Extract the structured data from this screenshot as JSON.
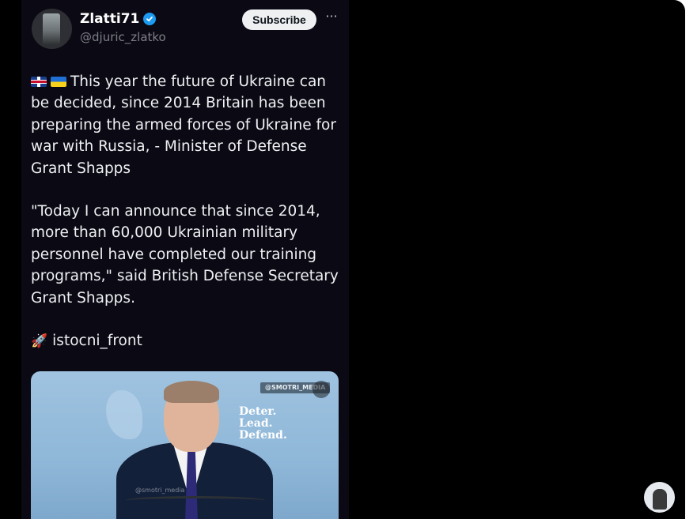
{
  "post": {
    "author_name": "Zlatti71",
    "author_handle": "@djuric_zlatko",
    "subscribe_label": "Subscribe",
    "more_label": "···",
    "paragraph1": "This year the future of Ukraine can be decided, since 2014 Britain has been preparing the armed forces of Ukraine for war with Russia, - Minister of Defense Grant Shapps",
    "paragraph2": "\"Today I can announce that since 2014, more than 60,000 Ukrainian military personnel have completed our training programs,\" said British Defense Secretary Grant Shapps.",
    "source": "istocni_front",
    "icons": [
      "uk-flag-icon",
      "ukraine-flag-icon",
      "rocket-icon",
      "verified-icon"
    ]
  },
  "media": {
    "watermark": "@SMOTRI_MEDIA",
    "slogan_line1": "Deter.",
    "slogan_line2": "Lead.",
    "slogan_line3": "Defend.",
    "overlay_watermark": "@smotri_media"
  },
  "colors": {
    "background": "#000000",
    "post_background": "#0b0a14",
    "verified": "#1d9bf0",
    "text": "#eef0f3",
    "handle": "#7d7f86"
  }
}
